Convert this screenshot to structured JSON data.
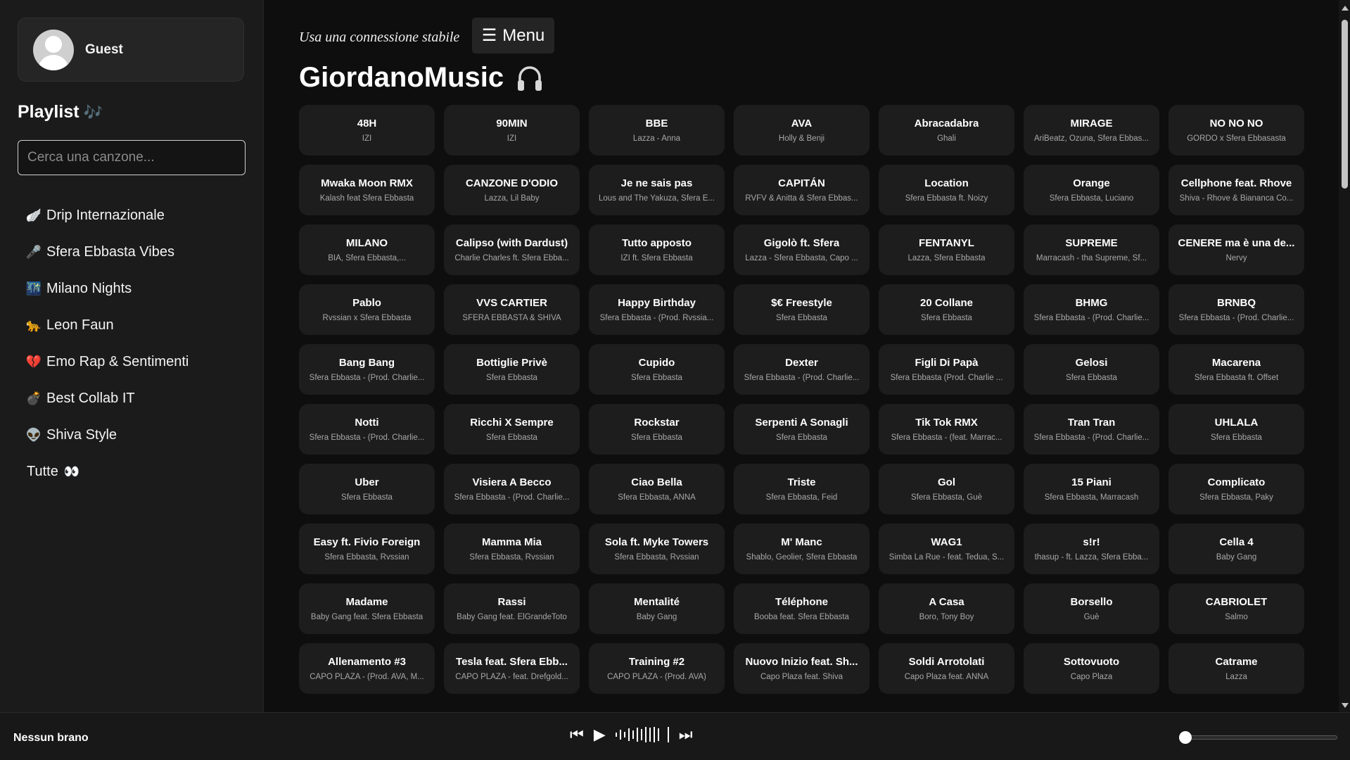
{
  "user": {
    "name": "Guest"
  },
  "sidebar": {
    "title": "Playlist",
    "title_icon": "🎶",
    "search_placeholder": "Cerca una canzone...",
    "items": [
      {
        "icon": "🪽",
        "label": "Drip Internazionale"
      },
      {
        "icon": "🎤",
        "label": "Sfera Ebbasta Vibes"
      },
      {
        "icon": "🌃",
        "label": "Milano Nights"
      },
      {
        "icon": "🐆",
        "label": "Leon Faun"
      },
      {
        "icon": "💔",
        "label": "Emo Rap & Sentimenti"
      },
      {
        "icon": "💣",
        "label": "Best Collab IT"
      },
      {
        "icon": "👽",
        "label": "Shiva Style"
      }
    ],
    "all_label": "Tutte",
    "all_icon": "👀"
  },
  "header": {
    "tagline": "Usa una connessione stabile",
    "menu_icon": "☰",
    "menu_label": "Menu",
    "brand": "GiordanoMusic"
  },
  "songs": [
    {
      "title": "48H",
      "artist": "IZI"
    },
    {
      "title": "90MIN",
      "artist": "IZI"
    },
    {
      "title": "BBE",
      "artist": "Lazza - Anna"
    },
    {
      "title": "AVA",
      "artist": "Holly & Benji"
    },
    {
      "title": "Abracadabra",
      "artist": "Ghali"
    },
    {
      "title": "MIRAGE",
      "artist": "AriBeatz, Ozuna, Sfera Ebbas..."
    },
    {
      "title": "NO NO NO",
      "artist": "GORDO x Sfera Ebbasasta"
    },
    {
      "title": "Mwaka Moon RMX",
      "artist": "Kalash feat Sfera Ebbasta"
    },
    {
      "title": "CANZONE D'ODIO",
      "artist": "Lazza, Lil Baby"
    },
    {
      "title": "Je ne sais pas",
      "artist": "Lous and The Yakuza, Sfera E..."
    },
    {
      "title": "CAPITÁN",
      "artist": "RVFV & Anitta & Sfera Ebbas..."
    },
    {
      "title": "Location",
      "artist": "Sfera Ebbasta ft. Noizy"
    },
    {
      "title": "Orange",
      "artist": "Sfera Ebbasta, Luciano"
    },
    {
      "title": "Cellphone feat. Rhove",
      "artist": "Shiva - Rhove & Biananca Co..."
    },
    {
      "title": "MILANO",
      "artist": "BIA, Sfera Ebbasta,..."
    },
    {
      "title": "Calipso (with Dardust)",
      "artist": "Charlie Charles ft. Sfera Ebba..."
    },
    {
      "title": "Tutto apposto",
      "artist": "IZI ft. Sfera Ebbasta"
    },
    {
      "title": "Gigolò ft. Sfera",
      "artist": "Lazza - Sfera Ebbasta, Capo ..."
    },
    {
      "title": "FENTANYL",
      "artist": "Lazza, Sfera Ebbasta"
    },
    {
      "title": "SUPREME",
      "artist": "Marracash - tha Supreme, Sf..."
    },
    {
      "title": "CENERE ma è una de...",
      "artist": "Nervy"
    },
    {
      "title": "Pablo",
      "artist": "Rvssian x Sfera Ebbasta"
    },
    {
      "title": "VVS CARTIER",
      "artist": "SFERA EBBASTA & SHIVA"
    },
    {
      "title": "Happy Birthday",
      "artist": "Sfera Ebbasta - (Prod. Rvssia..."
    },
    {
      "title": "$€ Freestyle",
      "artist": "Sfera Ebbasta"
    },
    {
      "title": "20 Collane",
      "artist": "Sfera Ebbasta"
    },
    {
      "title": "BHMG",
      "artist": "Sfera Ebbasta - (Prod. Charlie..."
    },
    {
      "title": "BRNBQ",
      "artist": "Sfera Ebbasta - (Prod. Charlie..."
    },
    {
      "title": "Bang Bang",
      "artist": "Sfera Ebbasta - (Prod. Charlie..."
    },
    {
      "title": "Bottiglie Privè",
      "artist": "Sfera Ebbasta"
    },
    {
      "title": "Cupido",
      "artist": "Sfera Ebbasta"
    },
    {
      "title": "Dexter",
      "artist": "Sfera Ebbasta - (Prod. Charlie..."
    },
    {
      "title": "Figli Di Papà",
      "artist": "Sfera Ebbasta (Prod. Charlie ..."
    },
    {
      "title": "Gelosi",
      "artist": "Sfera Ebbasta"
    },
    {
      "title": "Macarena",
      "artist": "Sfera Ebbasta ft. Offset"
    },
    {
      "title": "Notti",
      "artist": "Sfera Ebbasta - (Prod. Charlie..."
    },
    {
      "title": "Ricchi X Sempre",
      "artist": "Sfera Ebbasta"
    },
    {
      "title": "Rockstar",
      "artist": "Sfera Ebbasta"
    },
    {
      "title": "Serpenti A Sonagli",
      "artist": "Sfera Ebbasta"
    },
    {
      "title": "Tik Tok RMX",
      "artist": "Sfera Ebbasta - (feat. Marrac..."
    },
    {
      "title": "Tran Tran",
      "artist": "Sfera Ebbasta - (Prod. Charlie..."
    },
    {
      "title": "UHLALA",
      "artist": "Sfera Ebbasta"
    },
    {
      "title": "Uber",
      "artist": "Sfera Ebbasta"
    },
    {
      "title": "Visiera A Becco",
      "artist": "Sfera Ebbasta - (Prod. Charlie..."
    },
    {
      "title": "Ciao Bella",
      "artist": "Sfera Ebbasta, ANNA"
    },
    {
      "title": "Triste",
      "artist": "Sfera Ebbasta, Feid"
    },
    {
      "title": "Gol",
      "artist": "Sfera Ebbasta, Guè"
    },
    {
      "title": "15 Piani",
      "artist": "Sfera Ebbasta, Marracash"
    },
    {
      "title": "Complicato",
      "artist": "Sfera Ebbasta, Paky"
    },
    {
      "title": "Easy ft. Fivio Foreign",
      "artist": "Sfera Ebbasta, Rvssian"
    },
    {
      "title": "Mamma Mia",
      "artist": "Sfera Ebbasta, Rvssian"
    },
    {
      "title": "Sola ft. Myke Towers",
      "artist": "Sfera Ebbasta, Rvssian"
    },
    {
      "title": "M' Manc",
      "artist": "Shablo, Geolier, Sfera Ebbasta"
    },
    {
      "title": "WAG1",
      "artist": "Simba La Rue - feat. Tedua, S..."
    },
    {
      "title": "s!r!",
      "artist": "thasup - ft. Lazza, Sfera Ebba..."
    },
    {
      "title": "Cella 4",
      "artist": "Baby Gang"
    },
    {
      "title": "Madame",
      "artist": "Baby Gang feat. Sfera Ebbasta"
    },
    {
      "title": "Rassi",
      "artist": "Baby Gang feat. ElGrandeToto"
    },
    {
      "title": "Mentalité",
      "artist": "Baby Gang"
    },
    {
      "title": "Téléphone",
      "artist": "Booba feat. Sfera Ebbasta"
    },
    {
      "title": "A Casa",
      "artist": "Boro, Tony Boy"
    },
    {
      "title": "Borsello",
      "artist": "Guè"
    },
    {
      "title": "CABRIOLET",
      "artist": "Salmo"
    },
    {
      "title": "Allenamento #3",
      "artist": "CAPO PLAZA - (Prod. AVA, M..."
    },
    {
      "title": "Tesla feat. Sfera Ebb...",
      "artist": "CAPO PLAZA - feat. Drefgold..."
    },
    {
      "title": "Training #2",
      "artist": "CAPO PLAZA - (Prod. AVA)"
    },
    {
      "title": "Nuovo Inizio feat. Sh...",
      "artist": "Capo Plaza feat. Shiva"
    },
    {
      "title": "Soldi Arrotolati",
      "artist": "Capo Plaza feat. ANNA"
    },
    {
      "title": "Sottovuoto",
      "artist": "Capo Plaza"
    },
    {
      "title": "Catrame",
      "artist": "Lazza"
    }
  ],
  "player": {
    "now_playing": "Nessun brano",
    "prev_icon": "⏮",
    "play_icon": "▶",
    "next_icon": "⏭",
    "volume": 0
  }
}
